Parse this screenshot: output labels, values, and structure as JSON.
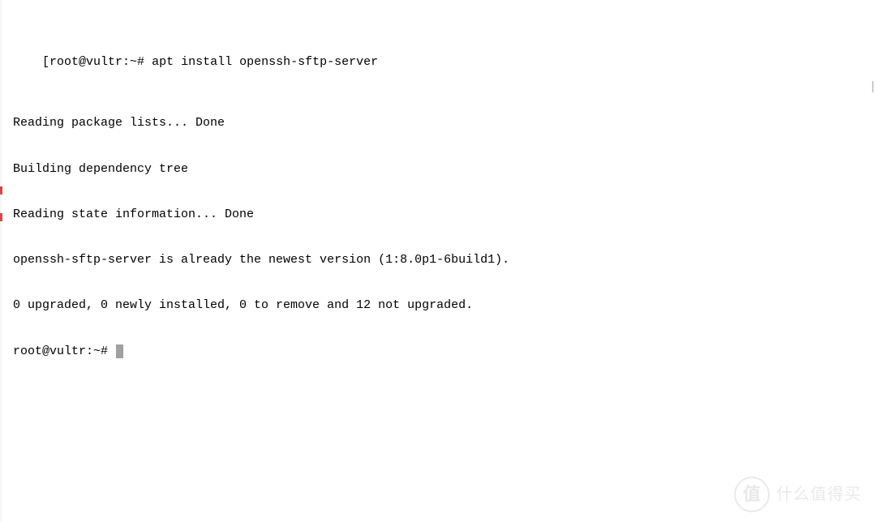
{
  "terminal": {
    "prompt_open": "[",
    "prompt_text": "root@vultr:~#",
    "prompt_close": "]",
    "command1": "apt install openssh-sftp-server",
    "output": [
      "Reading package lists... Done",
      "Building dependency tree",
      "Reading state information... Done",
      "openssh-sftp-server is already the newest version (1:8.0p1-6build1).",
      "0 upgraded, 0 newly installed, 0 to remove and 12 not upgraded."
    ],
    "prompt2_text": "root@vultr:~#"
  },
  "watermark": {
    "badge": "值",
    "text": "什么值得买"
  }
}
